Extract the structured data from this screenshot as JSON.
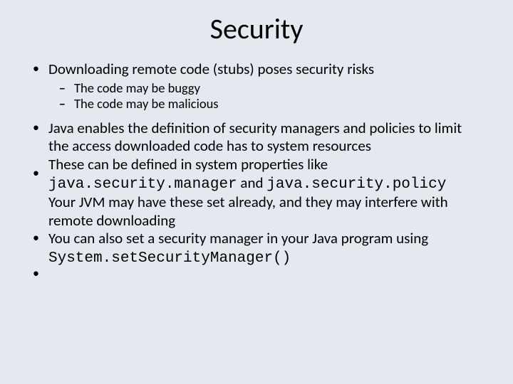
{
  "title": "Security",
  "bullet_glyph": "•",
  "dash_glyph": "–",
  "item1": "Downloading remote code (stubs) poses security risks",
  "sub1": "The code may be buggy",
  "sub2": "The code may be malicious",
  "p2a": "Java enables the definition of security managers and policies to limit the access downloaded code has to system resources",
  "p3a": "These can be defined in system properties like ",
  "p3code1": "java.security.manager",
  "p3mid": " and ",
  "p3code2": "java.security.policy",
  "p4a": "Your JVM may have these set already, and they may interfere with remote downloading",
  "p5a": "You can also set a security manager in your Java program using ",
  "p5code": "System.setSecurityManager()"
}
